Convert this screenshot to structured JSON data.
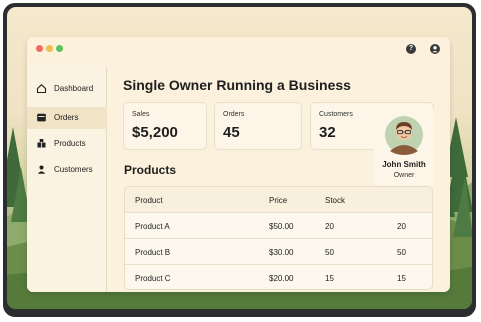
{
  "sidebar": {
    "items": [
      {
        "label": "Dashboard",
        "icon": "home-icon"
      },
      {
        "label": "Orders",
        "icon": "orders-icon"
      },
      {
        "label": "Products",
        "icon": "products-icon"
      },
      {
        "label": "Customers",
        "icon": "customers-icon"
      }
    ],
    "active_index": 1
  },
  "titlebar": {
    "help_icon": "?",
    "user_icon": "user-icon"
  },
  "main": {
    "title": "Single Owner Running a Business",
    "stats": [
      {
        "label": "Sales",
        "value": "$5,200"
      },
      {
        "label": "Orders",
        "value": "45"
      },
      {
        "label": "Customers",
        "value": "32"
      }
    ],
    "owner": {
      "name": "John Smith",
      "role": "Owner"
    },
    "products_title": "Products",
    "table": {
      "headers": [
        "Product",
        "Price",
        "Stock"
      ],
      "rows": [
        [
          "Product A",
          "$50.00",
          "20",
          "20"
        ],
        [
          "Product B",
          "$30.00",
          "50",
          "50"
        ],
        [
          "Product C",
          "$20.00",
          "15",
          "15"
        ]
      ]
    }
  },
  "colors": {
    "window_bg": "#fbf1dc",
    "accent_red": "#f26b5e",
    "accent_yellow": "#f5bd4f",
    "accent_green": "#5cc15a"
  }
}
